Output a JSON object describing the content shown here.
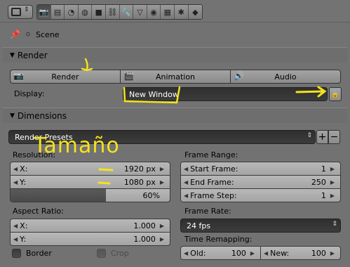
{
  "toolbar": {
    "editor_type_icon": "properties-editor-icon",
    "context_tabs": [
      {
        "icon": "render-icon",
        "glyph": "📷",
        "active": true
      },
      {
        "icon": "render-layers-icon",
        "glyph": "▤"
      },
      {
        "icon": "scene-icon",
        "glyph": "◔"
      },
      {
        "icon": "world-icon",
        "glyph": "◍"
      },
      {
        "icon": "object-icon",
        "glyph": "■"
      },
      {
        "icon": "object-constraints-icon",
        "glyph": "⛓"
      },
      {
        "icon": "modifiers-icon",
        "glyph": "🔧"
      },
      {
        "icon": "data-icon",
        "glyph": "▽"
      },
      {
        "icon": "material-icon",
        "glyph": "◉"
      },
      {
        "icon": "texture-icon",
        "glyph": "▦"
      },
      {
        "icon": "particles-icon",
        "glyph": "✱"
      },
      {
        "icon": "physics-icon",
        "glyph": "◆"
      }
    ]
  },
  "breadcrumb": {
    "pin_icon": "pin-icon",
    "scene_icon": "scene-icon",
    "scene_label": "Scene"
  },
  "render_panel": {
    "title": "Render",
    "buttons": [
      {
        "label": "Render",
        "icon": "render-still-icon"
      },
      {
        "label": "Animation",
        "icon": "clapperboard-icon"
      },
      {
        "label": "Audio",
        "icon": "speaker-icon"
      }
    ],
    "display_label": "Display:",
    "display_value": "New Window",
    "lock_icon": "lock-icon"
  },
  "dimensions_panel": {
    "title": "Dimensions",
    "presets_label": "Render Presets",
    "resolution_label": "Resolution:",
    "res_x_label": "X:",
    "res_x_value": "1920 px",
    "res_y_label": "Y:",
    "res_y_value": "1080 px",
    "res_percent_value": "60%",
    "res_percent": 60,
    "frame_range_label": "Frame Range:",
    "start_label": "Start Frame:",
    "start_value": "1",
    "end_label": "End Frame:",
    "end_value": "250",
    "step_label": "Frame Step:",
    "step_value": "1",
    "aspect_label": "Aspect Ratio:",
    "aspect_x_label": "X:",
    "aspect_x_value": "1.000",
    "aspect_y_label": "Y:",
    "aspect_y_value": "1.000",
    "frame_rate_label": "Frame Rate:",
    "frame_rate_value": "24 fps",
    "time_remap_label": "Time Remapping:",
    "old_label": "Old:",
    "old_value": "100",
    "new_label": "New:",
    "new_value": "100",
    "border_label": "Border",
    "crop_label": "Crop"
  },
  "annotation": {
    "handwritten_text": "Tamaño",
    "color": "#f5e21d"
  }
}
